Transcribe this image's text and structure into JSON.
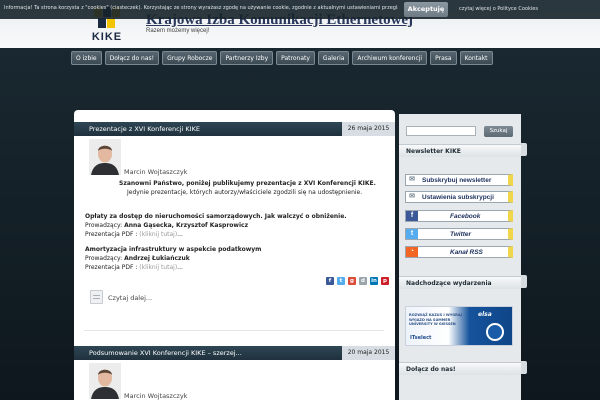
{
  "cookie_bar": {
    "text": "Informacja! Ta strona korzysta z \"cookies\" (ciasteczek). Korzystając ze strony wyrażasz zgodę na używanie cookie, zgodnie z aktualnymi ustawieniami przeglądarki.",
    "accept_label": "Akceptuję",
    "more_link": "czytaj więcej o Polityce Cookies"
  },
  "header": {
    "logo_text": "KIKE",
    "site_name": "Krajowa Izba Komunikacji Ethernetowej",
    "tagline": "Razem możemy więcej!"
  },
  "nav": {
    "items": [
      {
        "label": "O izbie"
      },
      {
        "label": "Dołącz do nas!"
      },
      {
        "label": "Grupy Robocze"
      },
      {
        "label": "Partnerzy Izby"
      },
      {
        "label": "Patronaty"
      },
      {
        "label": "Galeria"
      },
      {
        "label": "Archiwum konferencji"
      },
      {
        "label": "Prasa"
      },
      {
        "label": "Kontakt"
      }
    ]
  },
  "posts": [
    {
      "title": "Prezentacje z XVI Konferencji KIKE",
      "date": "26 maja 2015",
      "author": "Marcin Wojtaszczyk",
      "intro_bold": "Szanowni Państwo, poniżej publikujemy prezentacje z XVI Konferencji KIKE.",
      "intro_rest": "Jedynie prezentacje, których autorzy/właściciele zgodzili się na udostępnienie.",
      "sections": [
        {
          "title": "Opłaty za dostęp do nieruchomości samorządowych. Jak walczyć o obniżenie.",
          "speakers_label": "Prowadzący: ",
          "speakers": "Anna Gąsecka, Krzysztof Kasprowicz",
          "pdf_label": "Prezentacja PDF : ",
          "pdf_link": "(kliknij tutaj)",
          "after_link": "..."
        },
        {
          "title": "Amortyzacja infrastruktury w aspekcie podatkowym",
          "speakers_label": "Prowadzący: ",
          "speakers": "Andrzej Łukiańczuk",
          "pdf_label": "Prezentacja PDF : ",
          "pdf_link": "(kliknij tutaj)",
          "after_link": "..."
        }
      ],
      "read_more": "Czytaj dalej..."
    },
    {
      "title": "Podsumowanie XVI Konferencji KIKE – szerzej...",
      "date": "20 maja 2015",
      "author": "Marcin Wojtaszczyk"
    }
  ],
  "sidebar": {
    "search_button": "Szukaj",
    "newsletter_heading": "Newsletter KIKE",
    "buttons": [
      {
        "label": "Subskrybuj newsletter",
        "icon": "envelope-icon"
      },
      {
        "label": "Ustawienia subskrypcji",
        "icon": "envelope-icon"
      },
      {
        "label": "Facebook",
        "icon": "facebook-icon"
      },
      {
        "label": "Twitter",
        "icon": "twitter-icon"
      },
      {
        "label": "Kanał RSS",
        "icon": "rss-icon"
      }
    ],
    "events_heading": "Nadchodzące wydarzenia",
    "banner": {
      "text": "ROZWIĄŻ KAZUS I WYGRAJ WYJAZD NA SUMMER UNIVERSITY W GIESSEN",
      "brand": "ITselect",
      "logo": "elsa"
    },
    "join_heading": "Dołącz do nas!"
  },
  "colors": {
    "page_bg": "#1b2a33",
    "post_bar": "#2f4654",
    "accent_yellow": "#f0d64b",
    "link_gray": "#999999"
  }
}
